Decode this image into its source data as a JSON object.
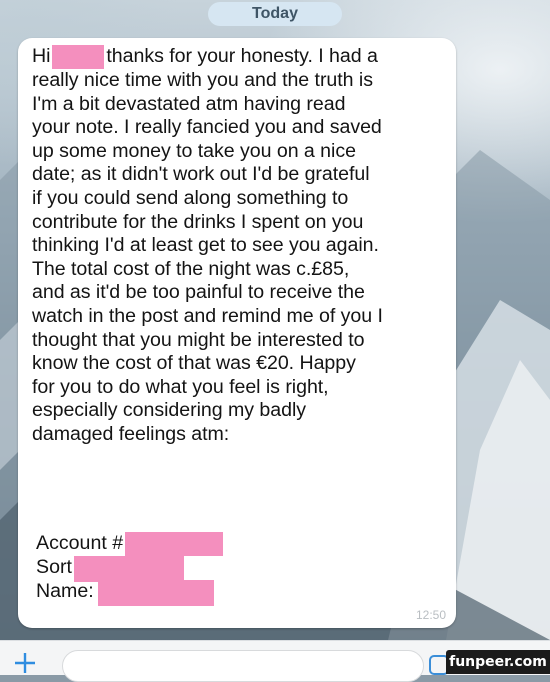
{
  "header": {
    "date_label": "Today"
  },
  "message": {
    "greeting": "Hi",
    "first_line_rest": "thanks for your honesty. I had a",
    "lines": [
      "really nice time with you and the truth is",
      "I'm a bit devastated atm having read",
      "your note. I really fancied you and saved",
      "up some money to take you on a nice",
      "date; as it didn't work out I'd be grateful",
      "if you could send along something to",
      "contribute for the drinks I spent on you",
      "thinking I'd at least get to see you again.",
      "The total cost of the night was c.£85,",
      "and as it'd be too painful to receive the",
      "watch in the post and remind me of you I",
      "thought that you might be interested to",
      "know the cost of that was €20. Happy",
      "for you to do what you feel is right,",
      "especially considering my badly",
      "damaged feelings atm:"
    ],
    "account_label": "Account #",
    "sort_label": "Sort",
    "name_label": "Name:",
    "timestamp": "12:50"
  },
  "watermark": {
    "text": "funpeer.com"
  },
  "colors": {
    "redaction": "#f48fbe",
    "bubble": "#ffffff",
    "date_pill": "#d6e6f2"
  }
}
